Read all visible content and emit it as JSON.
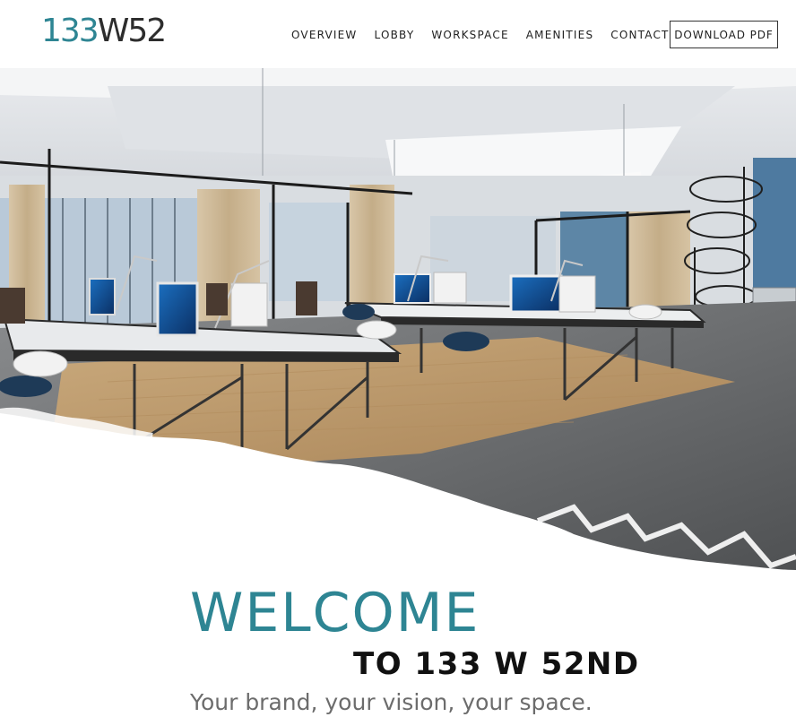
{
  "brand": {
    "logo_accent": "133",
    "logo_rest": "W52",
    "accent_color": "#2e8593"
  },
  "nav": {
    "items": [
      {
        "label": "OVERVIEW"
      },
      {
        "label": "LOBBY"
      },
      {
        "label": "WORKSPACE"
      },
      {
        "label": "AMENITIES"
      },
      {
        "label": "CONTACT"
      }
    ],
    "download_label": "DOWNLOAD PDF"
  },
  "hero": {
    "image_subject": "open-plan office workspace rendering"
  },
  "welcome": {
    "title": "WELCOME",
    "subtitle": "TO 133 W 52ND",
    "tagline": "Your brand, your vision, your space."
  }
}
